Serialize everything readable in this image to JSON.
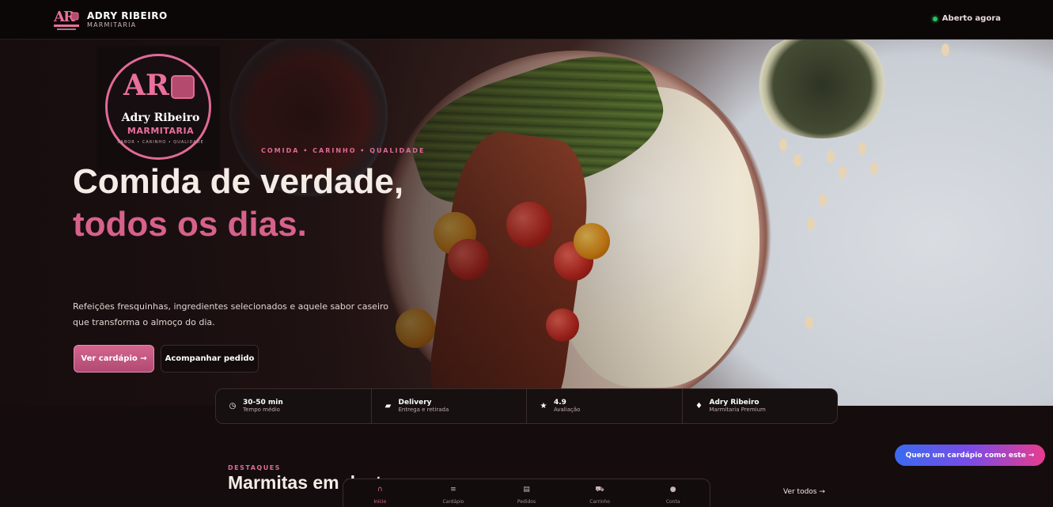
{
  "header": {
    "brand_name": "ADRY RIBEIRO",
    "brand_sub": "MARMITARIA",
    "status": "Aberto agora",
    "status_color": "#22c55e"
  },
  "logo": {
    "monogram": "AR",
    "name": "Adry Ribeiro",
    "sub": "MARMITARIA",
    "tagline": "SABOR • CARINHO • QUALIDADE"
  },
  "hero": {
    "eyebrow": "COMIDA • CARINHO • QUALIDADE",
    "headline_part1": "Comida de verdade, ",
    "headline_accent": "todos os dias.",
    "lead": "Refeições fresquinhas, ingredientes selecionados e aquele sabor caseiro que transforma o almoço do dia.",
    "primary_button": "Ver cardápio →",
    "secondary_button": "Acompanhar pedido"
  },
  "stats": [
    {
      "icon": "clock-icon",
      "title": "30-50 min",
      "sub": "Tempo médio"
    },
    {
      "icon": "delivery-icon",
      "title": "Delivery",
      "sub": "Entrega e retirada"
    },
    {
      "icon": "star-icon",
      "title": "4.9",
      "sub": "Avaliação"
    },
    {
      "icon": "diamond-icon",
      "title": "Adry Ribeiro",
      "sub": "Marmitaria Premium"
    }
  ],
  "featured": {
    "eyebrow": "DESTAQUES",
    "title": "Marmitas em destaque",
    "see_all": "Ver todos →"
  },
  "cta": "Quero um cardápio como este →",
  "bottom_nav": [
    {
      "icon": "home-icon",
      "label": "Início",
      "active": true
    },
    {
      "icon": "menu-icon",
      "label": "Cardápio",
      "active": false
    },
    {
      "icon": "orders-icon",
      "label": "Pedidos",
      "active": false
    },
    {
      "icon": "cart-icon",
      "label": "Carrinho",
      "active": false
    },
    {
      "icon": "account-icon",
      "label": "Conta",
      "active": false
    }
  ],
  "colors": {
    "accent": "#e06a97",
    "background": "#140c0d"
  }
}
